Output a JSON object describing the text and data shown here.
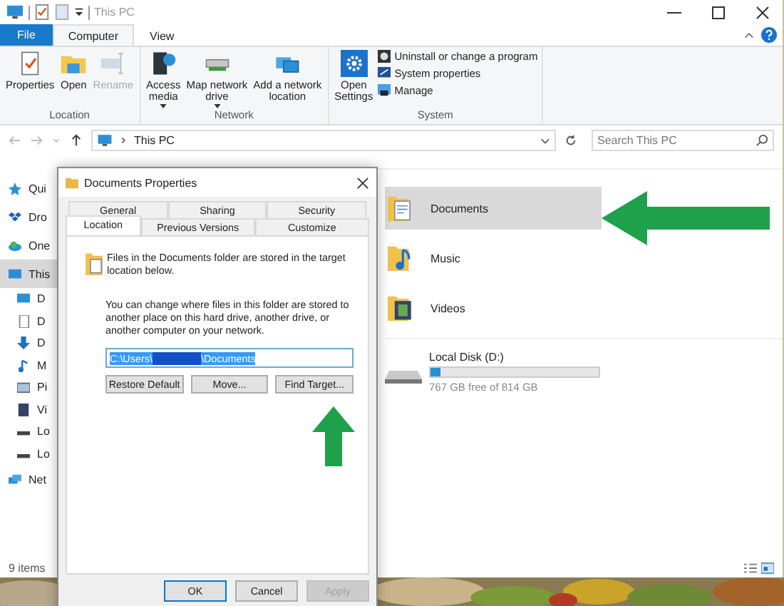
{
  "title_bar": {
    "title": "This PC"
  },
  "ribbon": {
    "tabs": [
      {
        "label": "File",
        "kind": "file",
        "selected": false
      },
      {
        "label": "Computer",
        "kind": "tab",
        "selected": true
      },
      {
        "label": "View",
        "kind": "tab",
        "selected": false
      }
    ],
    "groups": [
      {
        "label": "Location",
        "items": [
          {
            "label": "Properties",
            "disabled": false,
            "dropdown": false
          },
          {
            "label": "Open",
            "disabled": false,
            "dropdown": false
          },
          {
            "label": "Rename",
            "disabled": true,
            "dropdown": false
          }
        ]
      },
      {
        "label": "Network",
        "items": [
          {
            "label": "Access\nmedia",
            "disabled": false,
            "dropdown": true
          },
          {
            "label": "Map network\ndrive",
            "disabled": false,
            "dropdown": true
          },
          {
            "label": "Add a network\nlocation",
            "disabled": false,
            "dropdown": false
          }
        ]
      },
      {
        "label": "System",
        "items": [
          {
            "label": "Open\nSettings",
            "disabled": false,
            "dropdown": false
          }
        ],
        "small_items": [
          "Uninstall or change a program",
          "System properties",
          "Manage"
        ]
      }
    ]
  },
  "address_bar": {
    "path": "This PC",
    "search_placeholder": "Search This PC"
  },
  "sidebar": {
    "items": [
      {
        "label": "Qui",
        "selected": false
      },
      {
        "label": "Dro",
        "selected": false
      },
      {
        "label": "One",
        "selected": false
      },
      {
        "label": "This",
        "selected": true,
        "children": [
          {
            "label": "D",
            "selected": false
          },
          {
            "label": "D",
            "selected": false
          },
          {
            "label": "D",
            "selected": false
          },
          {
            "label": "M",
            "selected": false
          },
          {
            "label": "Pi",
            "selected": false
          },
          {
            "label": "Vi",
            "selected": false
          },
          {
            "label": "Lo",
            "selected": false
          },
          {
            "label": "Lo",
            "selected": false
          }
        ]
      },
      {
        "label": "Net",
        "selected": false
      }
    ]
  },
  "folders": [
    {
      "name": "Documents",
      "selected": true
    },
    {
      "name": "Music",
      "selected": false
    },
    {
      "name": "Videos",
      "selected": false
    }
  ],
  "drives": [
    {
      "name": "Local Disk (D:)",
      "level": 0.06,
      "free": "767 GB free of 814 GB"
    }
  ],
  "status_bar": {
    "count": "9 items"
  },
  "dialog": {
    "title": "Documents Properties",
    "tab_rows": [
      [
        {
          "label": "General",
          "selected": false
        },
        {
          "label": "Sharing",
          "selected": false
        },
        {
          "label": "Security",
          "selected": false
        }
      ],
      [
        {
          "label": "Location",
          "selected": true
        },
        {
          "label": "Previous Versions",
          "selected": false
        },
        {
          "label": "Customize",
          "selected": false
        }
      ]
    ],
    "info": "Files in the Documents folder are stored in the target location below.",
    "description": "You can change where files in this folder are stored to another place on this hard drive, another drive, or another computer on your network.",
    "path": {
      "prefix": "C:\\Users\\",
      "suffix": "\\Documents",
      "selected": true
    },
    "actions": [
      {
        "label": "Restore Default",
        "disabled": false
      },
      {
        "label": "Move...",
        "disabled": false
      },
      {
        "label": "Find Target...",
        "disabled": false
      }
    ],
    "footer": [
      {
        "label": "OK",
        "disabled": false,
        "default": true
      },
      {
        "label": "Cancel",
        "disabled": false,
        "default": false
      },
      {
        "label": "Apply",
        "disabled": true,
        "default": false
      }
    ]
  }
}
